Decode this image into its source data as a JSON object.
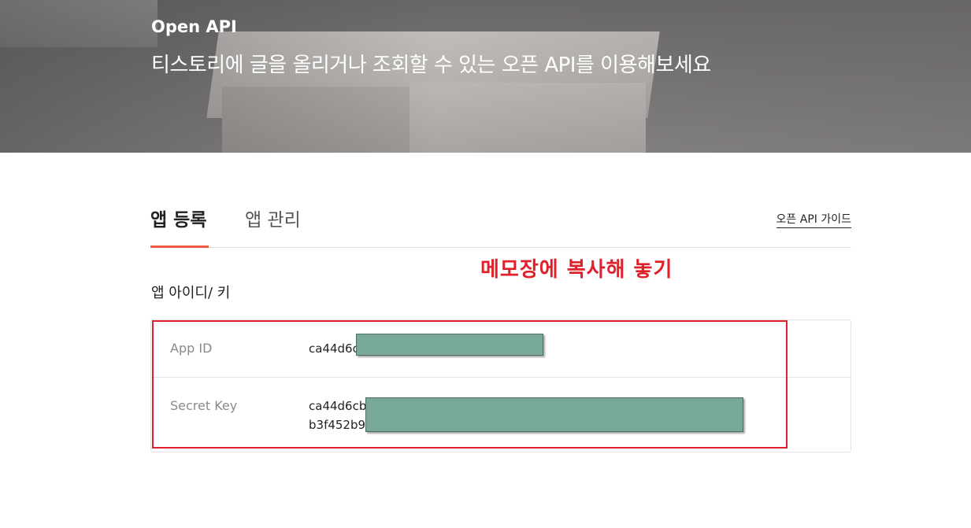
{
  "hero": {
    "title": "Open API",
    "subtitle": "티스토리에 글을 올리거나 조회할 수 있는 오픈 API를 이용해보세요"
  },
  "tabs": [
    {
      "label": "앱 등록",
      "active": true
    },
    {
      "label": "앱 관리",
      "active": false
    }
  ],
  "guide_link": "오픈 API 가이드",
  "annotation": {
    "memo": "메모장에 복사해 놓기",
    "color": "#e0202a"
  },
  "section": {
    "label": "앱 아이디/ 키"
  },
  "keys": {
    "app_id": {
      "label": "App ID",
      "value": "ca44d6c"
    },
    "secret_key": {
      "label": "Secret Key",
      "line1": "ca44d6cb",
      "line2": "b3f452b9"
    }
  },
  "colors": {
    "accent": "#ef5a40",
    "redaction": "#78a896"
  }
}
